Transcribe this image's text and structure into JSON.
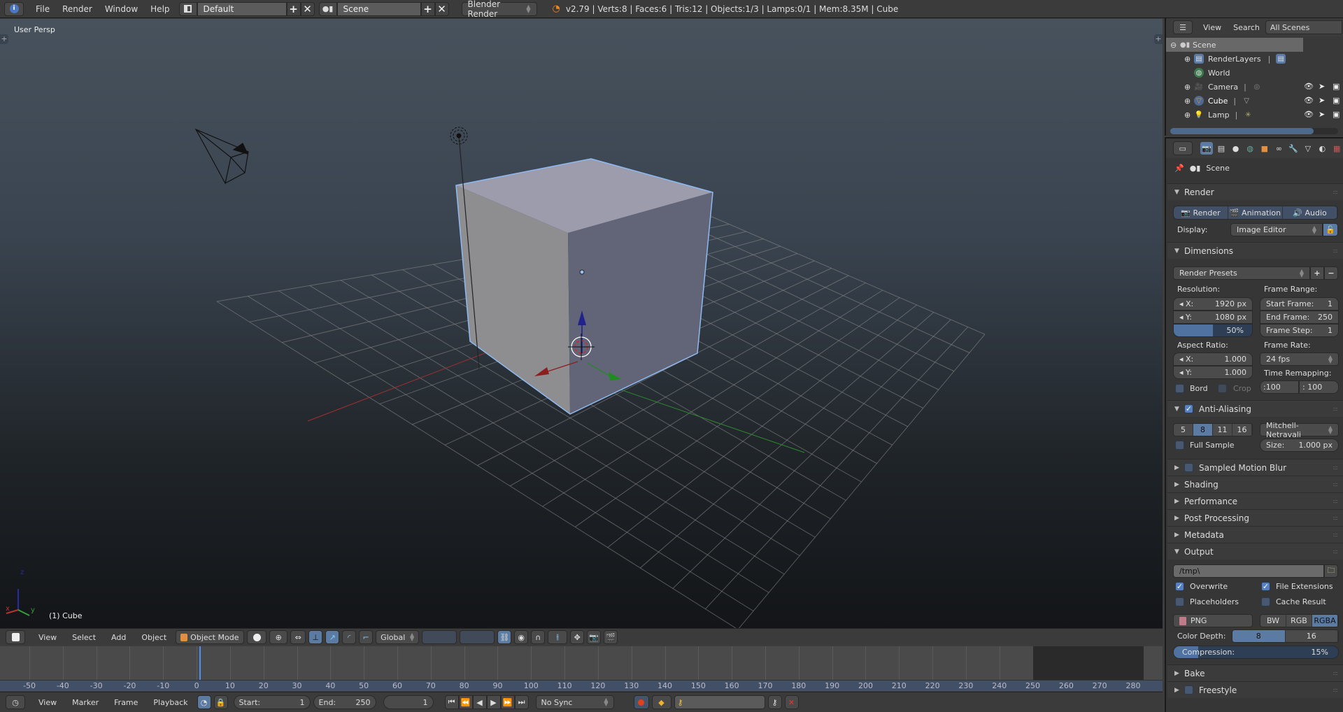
{
  "topbar": {
    "menus": [
      "File",
      "Render",
      "Window",
      "Help"
    ],
    "screen_layout": "Default",
    "scene": "Scene",
    "render_engine": "Blender Render",
    "stats": "v2.79 | Verts:8 | Faces:6 | Tris:12 | Objects:1/3 | Lamps:0/1 | Mem:8.35M | Cube"
  },
  "viewport": {
    "view_name": "User Persp",
    "active_object": "(1) Cube",
    "axis_labels": {
      "x": "x",
      "y": "y",
      "z": "z"
    },
    "colors": {
      "x_axis": "#b83232",
      "y_axis": "#35a035",
      "z_axis": "#2a2aa8",
      "selection_outline": "#8fbaf0"
    }
  },
  "view3d_header": {
    "menus": [
      "View",
      "Select",
      "Add",
      "Object"
    ],
    "mode": "Object Mode",
    "orientation": "Global"
  },
  "timeline": {
    "ruler_ticks": [
      -50,
      -40,
      -30,
      -20,
      -10,
      0,
      10,
      20,
      30,
      40,
      50,
      60,
      70,
      80,
      90,
      100,
      110,
      120,
      130,
      140,
      150,
      160,
      170,
      180,
      190,
      200,
      210,
      220,
      230,
      240,
      250,
      260,
      270,
      280
    ],
    "current_frame": 1,
    "menus": [
      "View",
      "Marker",
      "Frame",
      "Playback"
    ],
    "start_label": "Start:",
    "start": "1",
    "end_label": "End:",
    "end": "250",
    "frame": "1",
    "sync": "No Sync",
    "playhead_color": "#4d8ef5"
  },
  "outliner": {
    "header": {
      "view": "View",
      "search": "Search",
      "filter": "All Scenes"
    },
    "items": [
      {
        "name": "Scene",
        "level": 0,
        "selected": true
      },
      {
        "name": "RenderLayers",
        "level": 1
      },
      {
        "name": "World",
        "level": 1
      },
      {
        "name": "Camera",
        "level": 1
      },
      {
        "name": "Cube",
        "level": 1
      },
      {
        "name": "Lamp",
        "level": 1
      }
    ]
  },
  "properties": {
    "context": "Scene",
    "render": {
      "title": "Render",
      "buttons": [
        "Render",
        "Animation",
        "Audio"
      ],
      "display_label": "Display:",
      "display_value": "Image Editor"
    },
    "dimensions": {
      "title": "Dimensions",
      "presets": "Render Presets",
      "resolution_label": "Resolution:",
      "res_x": "1920 px",
      "res_y": "1080 px",
      "res_percent": "50%",
      "res_percent_value": 50,
      "aspect_label": "Aspect Ratio:",
      "aspect_x": "1.000",
      "aspect_y": "1.000",
      "border": "Bord",
      "crop": "Crop",
      "frame_range_label": "Frame Range:",
      "start_frame_label": "Start Frame:",
      "start_frame": "1",
      "end_frame_label": "End Frame:",
      "end_frame": "250",
      "frame_step_label": "Frame Step:",
      "frame_step": "1",
      "frame_rate_label": "Frame Rate:",
      "frame_rate": "24 fps",
      "time_remap_label": "Time Remapping:",
      "remap_old": ":100",
      "remap_new": ": 100"
    },
    "anti_aliasing": {
      "title": "Anti-Aliasing",
      "enabled": true,
      "samples": [
        "5",
        "8",
        "11",
        "16"
      ],
      "selected_sample": "8",
      "filter": "Mitchell-Netravali",
      "full_sample": "Full Sample",
      "size_label": "Size:",
      "size": "1.000 px"
    },
    "collapsed_panels": [
      "Sampled Motion Blur",
      "Shading",
      "Performance",
      "Post Processing",
      "Metadata"
    ],
    "output": {
      "title": "Output",
      "path": "/tmp\\",
      "overwrite": "Overwrite",
      "file_extensions": "File Extensions",
      "placeholders": "Placeholders",
      "cache_result": "Cache Result",
      "format": "PNG",
      "color_modes": [
        "BW",
        "RGB",
        "RGBA"
      ],
      "selected_color_mode": "RGBA",
      "color_depth_label": "Color Depth:",
      "color_depths": [
        "8",
        "16"
      ],
      "selected_color_depth": "8",
      "compression_label": "Compression:",
      "compression": "15%",
      "compression_value": 15
    },
    "bottom_panels": [
      "Bake",
      "Freestyle"
    ]
  }
}
